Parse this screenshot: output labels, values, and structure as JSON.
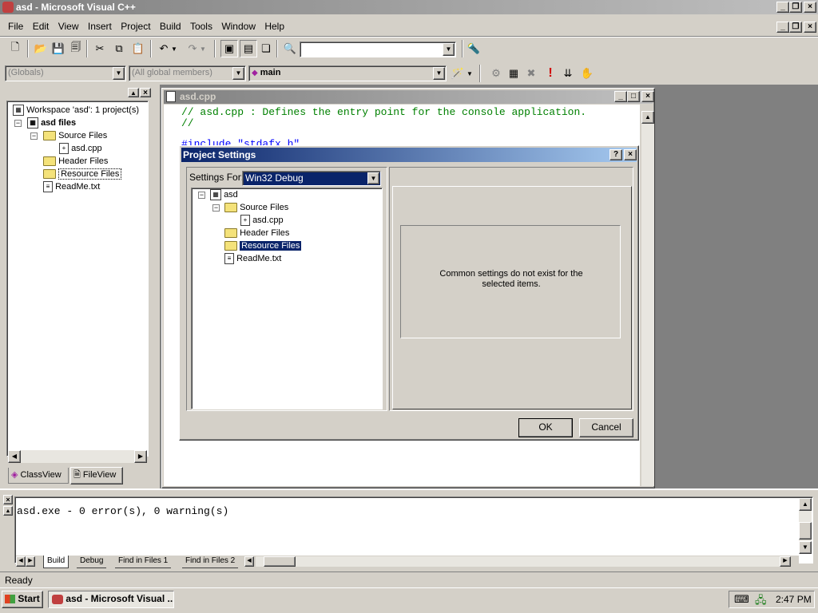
{
  "window": {
    "title": "asd - Microsoft Visual C++"
  },
  "menu": [
    "File",
    "Edit",
    "View",
    "Insert",
    "Project",
    "Build",
    "Tools",
    "Window",
    "Help"
  ],
  "toolbar2": {
    "globals": "(Globals)",
    "members": "(All global members)",
    "function": "main"
  },
  "workspace": {
    "root": "Workspace 'asd': 1 project(s)",
    "project": "asd files",
    "source": "Source Files",
    "cpp": "asd.cpp",
    "header": "Header Files",
    "resource": "Resource Files",
    "readme": "ReadMe.txt",
    "tab_class": "ClassView",
    "tab_file": "FileView"
  },
  "editor": {
    "title": "asd.cpp",
    "line1": "// asd.cpp : Defines the entry point for the console application.",
    "line2": "//",
    "line3": "#include \"stdafx.h\""
  },
  "dialog": {
    "title": "Project Settings",
    "settings_for_label": "Settings For:",
    "settings_for_value": "Win32 Debug",
    "tree": {
      "project": "asd",
      "source": "Source Files",
      "cpp": "asd.cpp",
      "header": "Header Files",
      "resource": "Resource Files",
      "readme": "ReadMe.txt"
    },
    "message_line1": "Common settings do not exist for the",
    "message_line2": "selected items.",
    "ok": "OK",
    "cancel": "Cancel"
  },
  "output": {
    "text": "asd.exe - 0 error(s), 0 warning(s)",
    "tabs": [
      "Build",
      "Debug",
      "Find in Files 1",
      "Find in Files 2"
    ]
  },
  "status": {
    "text": "Ready"
  },
  "taskbar": {
    "start": "Start",
    "task": "asd - Microsoft Visual ...",
    "clock": "2:47 PM"
  },
  "colors": {
    "title_active": "#0a246a",
    "title_gradient_end": "#a6caf0",
    "face": "#d4d0c8",
    "comment_green": "#008000",
    "desktop_gray": "#808080"
  }
}
